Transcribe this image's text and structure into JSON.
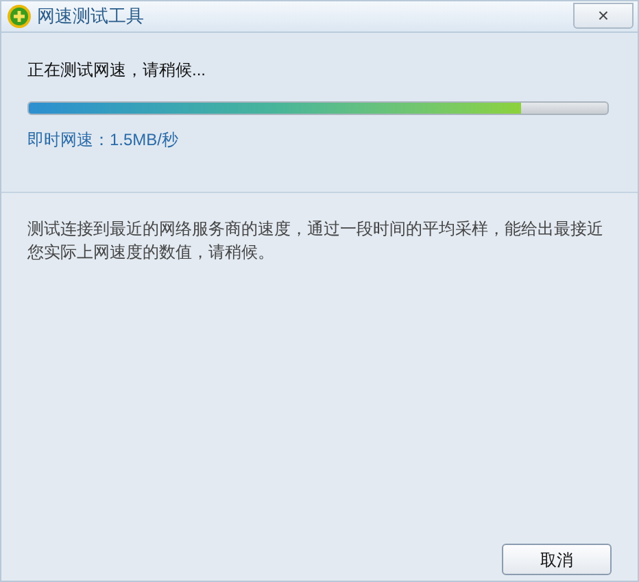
{
  "window": {
    "title": "网速测试工具",
    "close": "×"
  },
  "status": "正在测试网速，请稍候...",
  "progress": {
    "level": 0.85
  },
  "speed": "即时网速：1.5MB/秒",
  "description": "测试连接到最近的网络服务商的速度，通过一段时间的平均采样，能给出最接近您实际上网速度的数值，请稍候。",
  "buttons": [
    "取消"
  ]
}
